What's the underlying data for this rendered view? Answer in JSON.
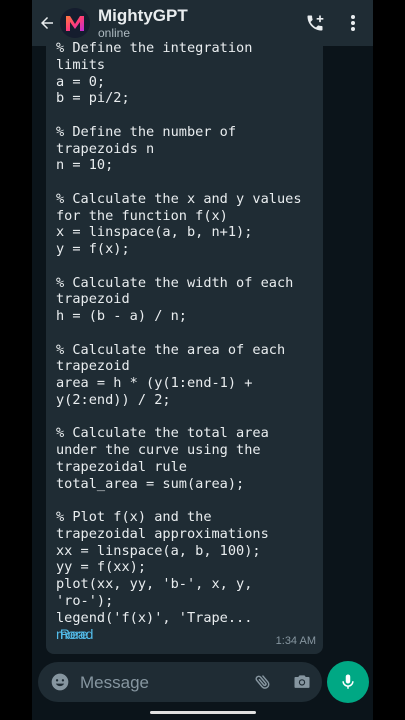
{
  "header": {
    "title": "MightyGPT",
    "status": "online",
    "avatar_letter": "M"
  },
  "message": {
    "lines": [
      "% Define the integration",
      "limits",
      "a = 0;",
      "b = pi/2;",
      "",
      "% Define the number of",
      "trapezoids n",
      "n = 10;",
      "",
      "% Calculate the x and y values",
      "for the function f(x)",
      "x = linspace(a, b, n+1);",
      "y = f(x);",
      "",
      "% Calculate the width of each",
      "trapezoid",
      "h = (b - a) / n;",
      "",
      "% Calculate the area of each",
      "trapezoid",
      "area = h * (y(1:end-1) +",
      "y(2:end)) / 2;",
      "",
      "% Calculate the total area",
      "under the curve using the",
      "trapezoidal rule",
      "total_area = sum(area);",
      "",
      "% Plot f(x) and the",
      "trapezoidal approximations",
      "xx = linspace(a, b, 100);",
      "yy = f(xx);",
      "plot(xx, yy, 'b-', x, y,",
      "'ro-');"
    ],
    "last_line": "legend('f(x)', 'Trape...",
    "read_more_1": "Read",
    "read_more_2": "more",
    "time": "1:34 AM"
  },
  "composer": {
    "placeholder": "Message"
  },
  "colors": {
    "header_bg": "#1f2c34",
    "chat_bg": "#0b141a",
    "bubble_bg": "#1f2c34",
    "accent_green": "#00a884",
    "link_blue": "#53bdeb"
  },
  "icons": {
    "back": "back-arrow-icon",
    "add_call": "add-call-icon",
    "menu": "more-vert-icon",
    "emoji": "emoji-icon",
    "attach": "paperclip-icon",
    "camera": "camera-icon",
    "mic": "mic-icon"
  }
}
